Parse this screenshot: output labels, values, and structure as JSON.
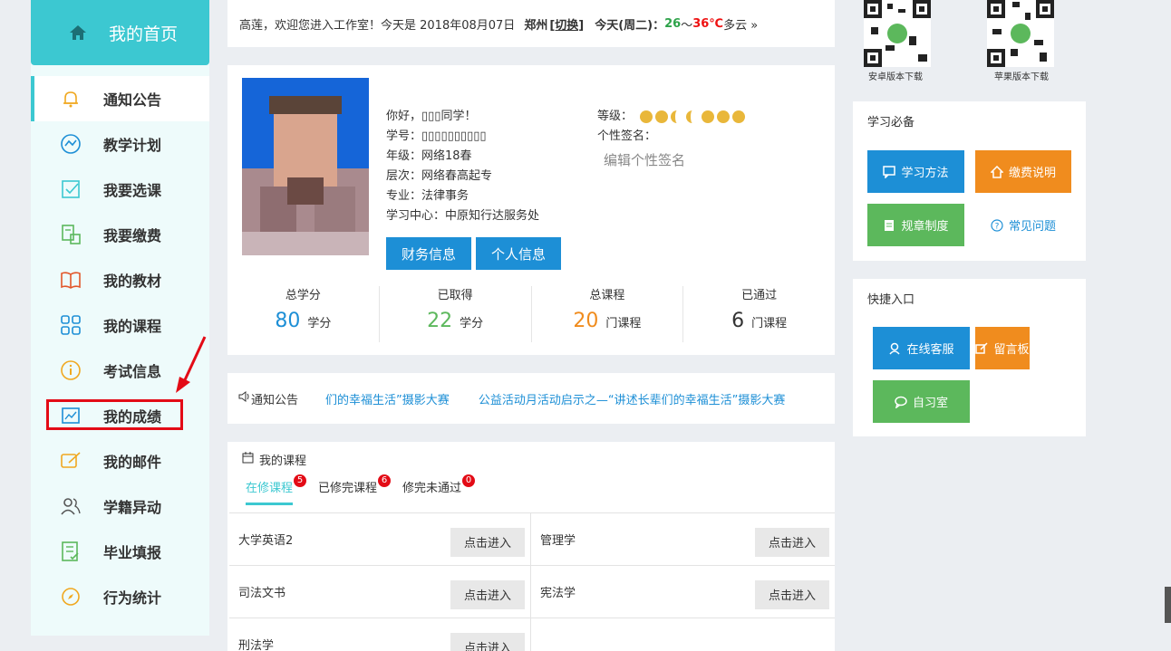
{
  "sidebar": {
    "home_label": "我的首页",
    "items": [
      {
        "label": "通知公告",
        "icon": "bell-icon"
      },
      {
        "label": "教学计划",
        "icon": "chart-line-icon"
      },
      {
        "label": "我要选课",
        "icon": "checkbox-icon"
      },
      {
        "label": "我要缴费",
        "icon": "payment-icon"
      },
      {
        "label": "我的教材",
        "icon": "book-icon"
      },
      {
        "label": "我的课程",
        "icon": "grid-icon"
      },
      {
        "label": "考试信息",
        "icon": "info-icon"
      },
      {
        "label": "我的成绩",
        "icon": "score-icon"
      },
      {
        "label": "我的邮件",
        "icon": "mail-edit-icon"
      },
      {
        "label": "学籍异动",
        "icon": "users-icon"
      },
      {
        "label": "毕业填报",
        "icon": "list-check-icon"
      },
      {
        "label": "行为统计",
        "icon": "compass-icon"
      }
    ]
  },
  "welcome": {
    "text": "高莲，欢迎您进入工作室！今天是 2018年08月07日",
    "city": "郑州",
    "switch": "[切换]",
    "weather_prefix": "今天(周二)：",
    "temp_low": "26",
    "temp_sep": "～",
    "temp_high": "36℃",
    "weather": "多云 »"
  },
  "profile": {
    "greeting": "你好，▯▯▯同学！",
    "student_id": "学号：▯▯▯▯▯▯▯▯▯▯",
    "grade": "年级：网络18春",
    "level": "层次：网络春高起专",
    "major": "专业：法律事务",
    "center": "学习中心：中原知行达服务处",
    "rank_label": "等级：",
    "signature_label": "个性签名：",
    "signature_placeholder": "编辑个性签名",
    "btn_finance": "财务信息",
    "btn_personal": "个人信息"
  },
  "stats": [
    {
      "label": "总学分",
      "value": "80",
      "unit": "学分",
      "color": "#1d8fd6"
    },
    {
      "label": "已取得",
      "value": "22",
      "unit": "学分",
      "color": "#5cb85c"
    },
    {
      "label": "总课程",
      "value": "20",
      "unit": "门课程",
      "color": "#f08c1e"
    },
    {
      "label": "已通过",
      "value": "6",
      "unit": "门课程",
      "color": "#333333"
    }
  ],
  "notice": {
    "label": "通知公告",
    "items": [
      "们的幸福生活”摄影大赛",
      "公益活动月活动启示之—“讲述长辈们的幸福生活”摄影大赛"
    ]
  },
  "courses": {
    "title": "我的课程",
    "tabs": [
      {
        "label": "在修课程",
        "count": "5"
      },
      {
        "label": "已修完课程",
        "count": "6"
      },
      {
        "label": "修完未通过",
        "count": "0"
      }
    ],
    "enter_label": "点击进入",
    "list": [
      "大学英语2",
      "管理学",
      "司法文书",
      "宪法学",
      "刑法学",
      ""
    ]
  },
  "right": {
    "qr_android": "安卓版本下载",
    "qr_ios": "苹果版本下载",
    "study_title": "学习必备",
    "study_method": "学习方法",
    "fee_info": "缴费说明",
    "rules": "规章制度",
    "faq": "常见问题",
    "quick_title": "快捷入口",
    "online_service": "在线客服",
    "message_board": "留言板",
    "study_room": "自习室"
  }
}
